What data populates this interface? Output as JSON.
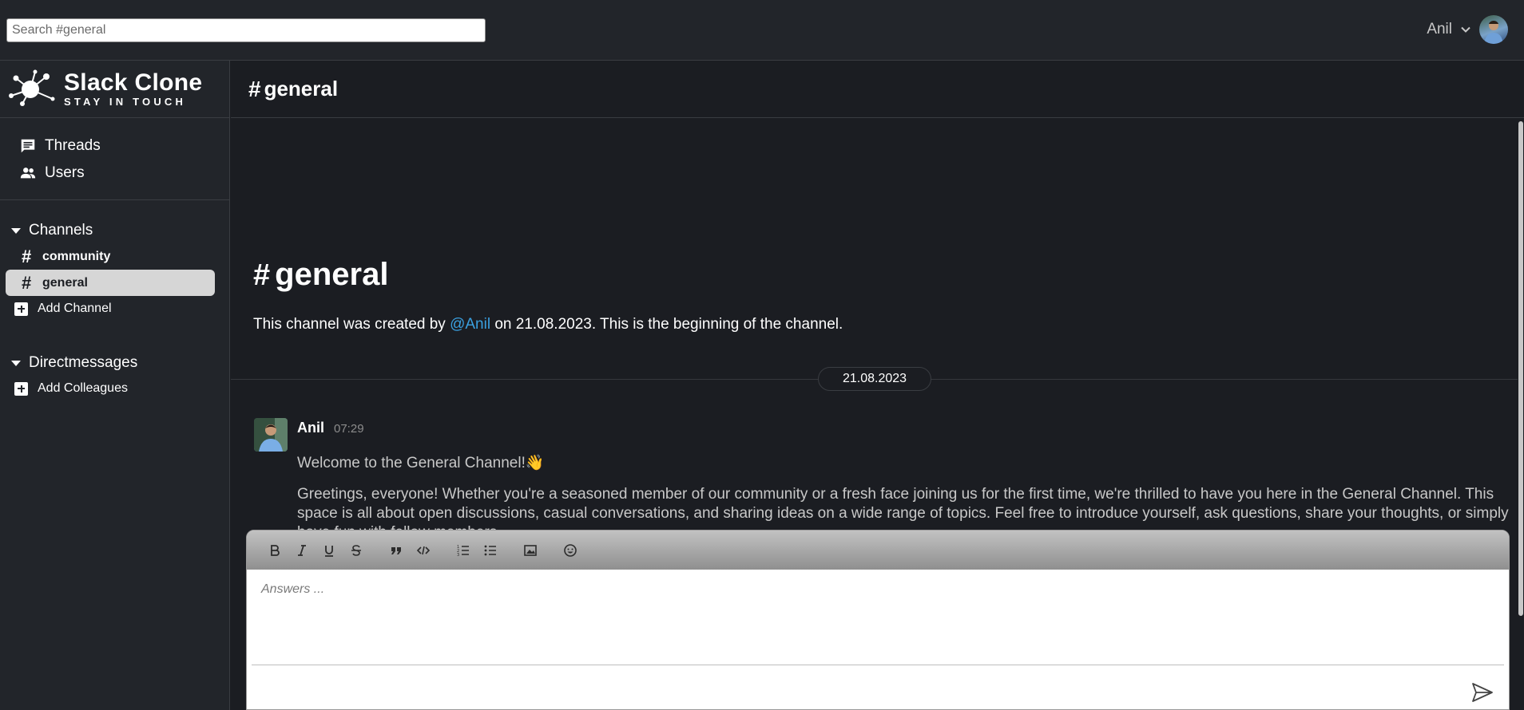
{
  "search": {
    "placeholder": "Search #general"
  },
  "user": {
    "name": "Anil"
  },
  "brand": {
    "title": "Slack Clone",
    "subtitle": "STAY IN TOUCH"
  },
  "nav": {
    "threads": "Threads",
    "users": "Users"
  },
  "channels": {
    "heading": "Channels",
    "items": [
      {
        "name": "community",
        "active": false
      },
      {
        "name": "general",
        "active": true
      }
    ],
    "add_label": "Add Channel"
  },
  "directmessages": {
    "heading": "Directmessages",
    "add_label": "Add Colleagues"
  },
  "main": {
    "channel_title": "general",
    "intro_title": "general",
    "intro_prefix": "This channel was created by ",
    "intro_mention": "@Anil",
    "intro_suffix": " on 21.08.2023. This is the beginning of the channel.",
    "date_divider": "21.08.2023"
  },
  "message": {
    "author": "Anil",
    "time": "07:29",
    "title": "Welcome to the General Channel!👋",
    "body": "Greetings, everyone! Whether you're a seasoned member of our community or a fresh face joining us for the first time, we're thrilled to have you here in the General Channel. This space is all about open discussions, casual conversations, and sharing ideas on a wide range of topics. Feel free to introduce yourself, ask questions, share your thoughts, or simply have fun with fellow members."
  },
  "editor": {
    "placeholder": "Answers ...",
    "toolbar": [
      "bold-icon",
      "italic-icon",
      "underline-icon",
      "strikethrough-icon",
      "blockquote-icon",
      "code-icon",
      "ordered-list-icon",
      "bullet-list-icon",
      "image-icon",
      "emoji-icon"
    ]
  },
  "colors": {
    "background": "#1b1d22",
    "sidebar": "#22252a",
    "mention": "#3aa0e0",
    "active_channel": "#d6d6d6"
  }
}
